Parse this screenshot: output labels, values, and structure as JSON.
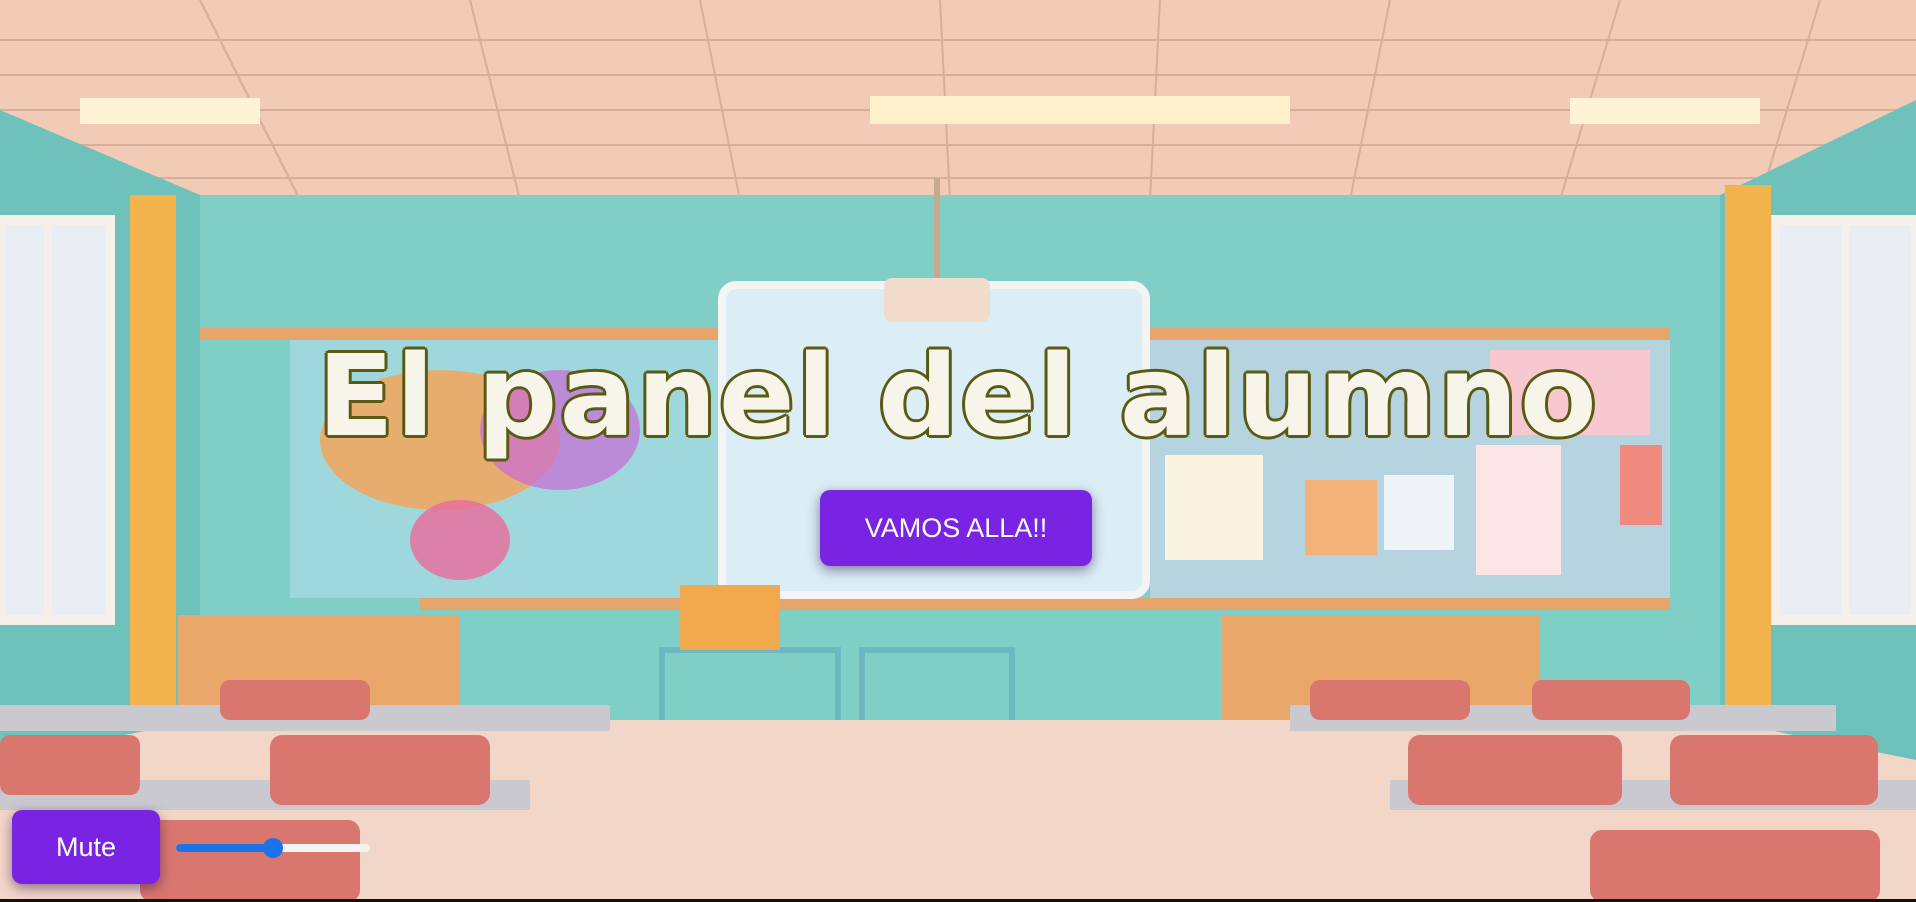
{
  "page": {
    "title": "El panel del alumno",
    "start_button_label": "VAMOS ALLA!!",
    "mute_button_label": "Mute"
  },
  "volume": {
    "level": 0.5
  },
  "background": {
    "image": "classroom-illustration"
  },
  "colors": {
    "accent": "#7a24e3",
    "slider": "#1a73e8",
    "title_fill": "#f7f5ea",
    "title_outline": "#5a5a14"
  }
}
